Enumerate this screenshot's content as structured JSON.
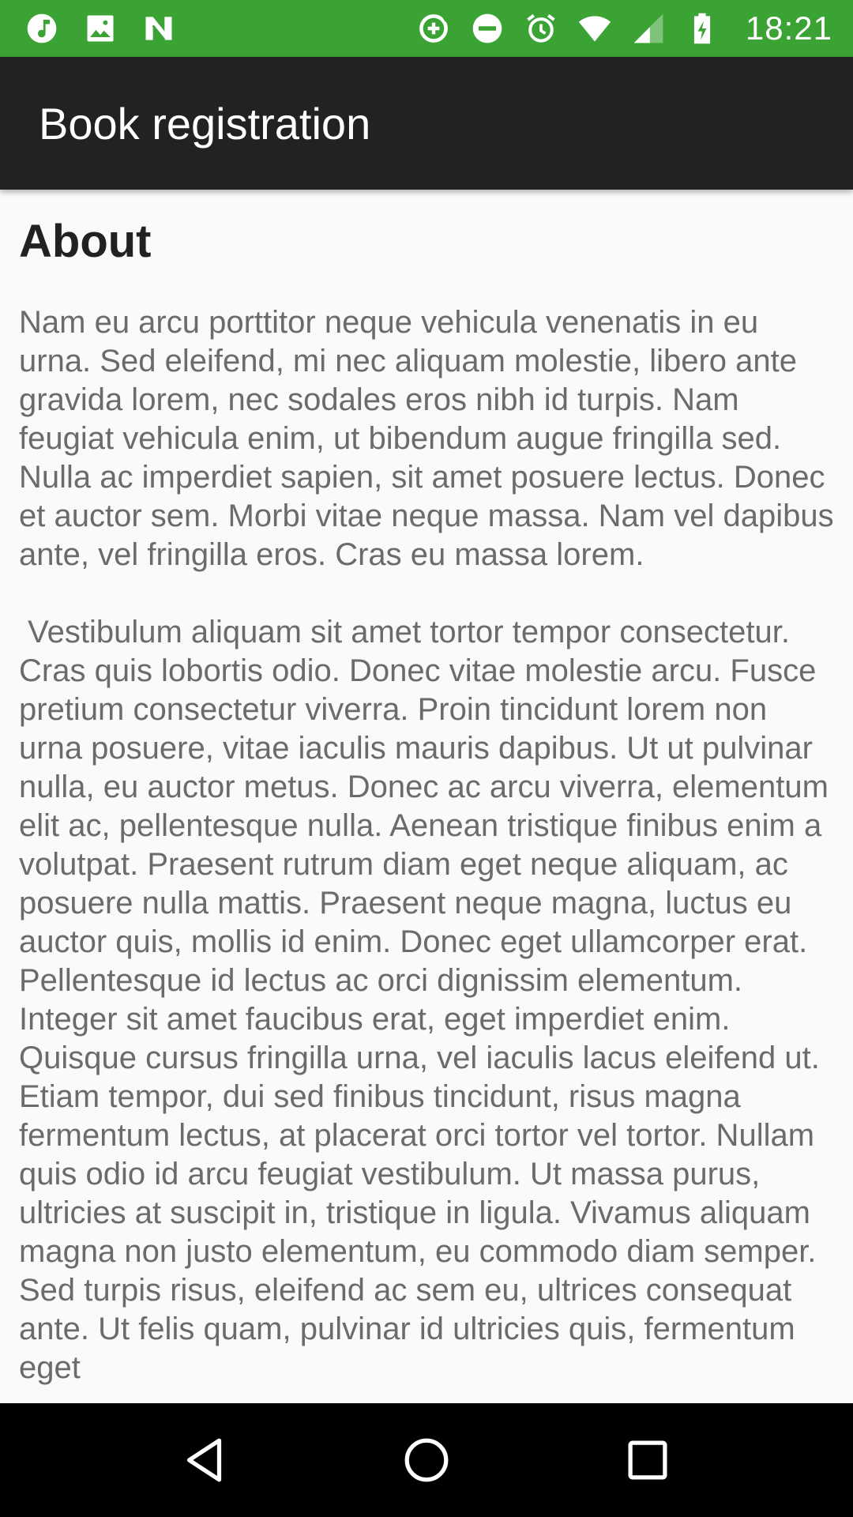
{
  "status_bar": {
    "background": "#3aa334",
    "time": "18:21",
    "left_icons": [
      "music-note-icon",
      "image-icon",
      "n-notification-icon"
    ],
    "right_icons": [
      "data-saver-icon",
      "do-not-disturb-icon",
      "alarm-icon",
      "wifi-icon",
      "cellular-signal-icon",
      "battery-charging-icon"
    ]
  },
  "app_bar": {
    "title": "Book registration",
    "background": "#222222"
  },
  "content": {
    "heading": "About",
    "paragraphs": [
      "Nam eu arcu porttitor neque vehicula venenatis in eu urna. Sed eleifend, mi nec aliquam molestie, libero ante gravida lorem, nec sodales eros nibh id turpis. Nam feugiat vehicula enim, ut bibendum augue fringilla sed. Nulla ac imperdiet sapien, sit amet posuere lectus. Do­nec et auctor sem. Morbi vitae neque massa. Nam vel dapibus ante, vel fringilla eros. Cras eu massa lorem.",
      " Vestibulum aliquam sit amet tortor tempor consecte­tur. Cras quis lobortis odio. Donec vitae molestie arcu. Fusce pretium consectetur viverra. Proin tincidunt lorem non urna posuere, vitae iaculis mauris dapibus. Ut ut pulvinar nulla, eu auctor metus. Donec ac arcu viverra, elementum elit ac, pellentesque nulla. Aenean tristique finibus enim a volutpat. Praesent rutrum diam eget neque aliquam, ac posuere nulla mattis. Praesent neque magna, luctus eu auctor quis, mollis id enim. Donec eget ullamcorper erat. Pellentesque id lectus ac orci dignissim elementum. Integer sit amet faucibus erat, eget imperdiet enim. Quisque cursus fringilla urna, vel iaculis lacus eleifend ut. Etiam tempor, dui sed finibus tincidunt, risus magna fermentum lectus, at placerat orci tortor vel tortor. Nullam quis odio id arcu feugiat vestibulum. Ut massa purus, ultricies at suscipit in, tristique in ligula. Vivamus aliquam magna non justo elementum, eu commodo diam semper. Sed turpis risus, eleifend ac sem eu, ultrices consequat ante. Ut felis quam, pulvinar id ultricies quis, fermentum eget"
    ]
  },
  "nav_bar": {
    "buttons": [
      "back-icon",
      "home-icon",
      "recents-icon"
    ]
  }
}
